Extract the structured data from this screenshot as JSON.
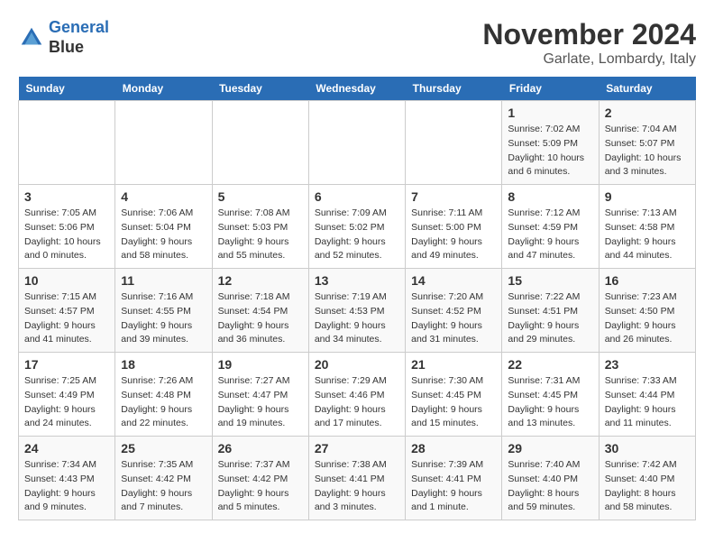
{
  "header": {
    "logo_line1": "General",
    "logo_line2": "Blue",
    "month_title": "November 2024",
    "location": "Garlate, Lombardy, Italy"
  },
  "weekdays": [
    "Sunday",
    "Monday",
    "Tuesday",
    "Wednesday",
    "Thursday",
    "Friday",
    "Saturday"
  ],
  "weeks": [
    [
      {
        "day": "",
        "info": ""
      },
      {
        "day": "",
        "info": ""
      },
      {
        "day": "",
        "info": ""
      },
      {
        "day": "",
        "info": ""
      },
      {
        "day": "",
        "info": ""
      },
      {
        "day": "1",
        "info": "Sunrise: 7:02 AM\nSunset: 5:09 PM\nDaylight: 10 hours\nand 6 minutes."
      },
      {
        "day": "2",
        "info": "Sunrise: 7:04 AM\nSunset: 5:07 PM\nDaylight: 10 hours\nand 3 minutes."
      }
    ],
    [
      {
        "day": "3",
        "info": "Sunrise: 7:05 AM\nSunset: 5:06 PM\nDaylight: 10 hours\nand 0 minutes."
      },
      {
        "day": "4",
        "info": "Sunrise: 7:06 AM\nSunset: 5:04 PM\nDaylight: 9 hours\nand 58 minutes."
      },
      {
        "day": "5",
        "info": "Sunrise: 7:08 AM\nSunset: 5:03 PM\nDaylight: 9 hours\nand 55 minutes."
      },
      {
        "day": "6",
        "info": "Sunrise: 7:09 AM\nSunset: 5:02 PM\nDaylight: 9 hours\nand 52 minutes."
      },
      {
        "day": "7",
        "info": "Sunrise: 7:11 AM\nSunset: 5:00 PM\nDaylight: 9 hours\nand 49 minutes."
      },
      {
        "day": "8",
        "info": "Sunrise: 7:12 AM\nSunset: 4:59 PM\nDaylight: 9 hours\nand 47 minutes."
      },
      {
        "day": "9",
        "info": "Sunrise: 7:13 AM\nSunset: 4:58 PM\nDaylight: 9 hours\nand 44 minutes."
      }
    ],
    [
      {
        "day": "10",
        "info": "Sunrise: 7:15 AM\nSunset: 4:57 PM\nDaylight: 9 hours\nand 41 minutes."
      },
      {
        "day": "11",
        "info": "Sunrise: 7:16 AM\nSunset: 4:55 PM\nDaylight: 9 hours\nand 39 minutes."
      },
      {
        "day": "12",
        "info": "Sunrise: 7:18 AM\nSunset: 4:54 PM\nDaylight: 9 hours\nand 36 minutes."
      },
      {
        "day": "13",
        "info": "Sunrise: 7:19 AM\nSunset: 4:53 PM\nDaylight: 9 hours\nand 34 minutes."
      },
      {
        "day": "14",
        "info": "Sunrise: 7:20 AM\nSunset: 4:52 PM\nDaylight: 9 hours\nand 31 minutes."
      },
      {
        "day": "15",
        "info": "Sunrise: 7:22 AM\nSunset: 4:51 PM\nDaylight: 9 hours\nand 29 minutes."
      },
      {
        "day": "16",
        "info": "Sunrise: 7:23 AM\nSunset: 4:50 PM\nDaylight: 9 hours\nand 26 minutes."
      }
    ],
    [
      {
        "day": "17",
        "info": "Sunrise: 7:25 AM\nSunset: 4:49 PM\nDaylight: 9 hours\nand 24 minutes."
      },
      {
        "day": "18",
        "info": "Sunrise: 7:26 AM\nSunset: 4:48 PM\nDaylight: 9 hours\nand 22 minutes."
      },
      {
        "day": "19",
        "info": "Sunrise: 7:27 AM\nSunset: 4:47 PM\nDaylight: 9 hours\nand 19 minutes."
      },
      {
        "day": "20",
        "info": "Sunrise: 7:29 AM\nSunset: 4:46 PM\nDaylight: 9 hours\nand 17 minutes."
      },
      {
        "day": "21",
        "info": "Sunrise: 7:30 AM\nSunset: 4:45 PM\nDaylight: 9 hours\nand 15 minutes."
      },
      {
        "day": "22",
        "info": "Sunrise: 7:31 AM\nSunset: 4:45 PM\nDaylight: 9 hours\nand 13 minutes."
      },
      {
        "day": "23",
        "info": "Sunrise: 7:33 AM\nSunset: 4:44 PM\nDaylight: 9 hours\nand 11 minutes."
      }
    ],
    [
      {
        "day": "24",
        "info": "Sunrise: 7:34 AM\nSunset: 4:43 PM\nDaylight: 9 hours\nand 9 minutes."
      },
      {
        "day": "25",
        "info": "Sunrise: 7:35 AM\nSunset: 4:42 PM\nDaylight: 9 hours\nand 7 minutes."
      },
      {
        "day": "26",
        "info": "Sunrise: 7:37 AM\nSunset: 4:42 PM\nDaylight: 9 hours\nand 5 minutes."
      },
      {
        "day": "27",
        "info": "Sunrise: 7:38 AM\nSunset: 4:41 PM\nDaylight: 9 hours\nand 3 minutes."
      },
      {
        "day": "28",
        "info": "Sunrise: 7:39 AM\nSunset: 4:41 PM\nDaylight: 9 hours\nand 1 minute."
      },
      {
        "day": "29",
        "info": "Sunrise: 7:40 AM\nSunset: 4:40 PM\nDaylight: 8 hours\nand 59 minutes."
      },
      {
        "day": "30",
        "info": "Sunrise: 7:42 AM\nSunset: 4:40 PM\nDaylight: 8 hours\nand 58 minutes."
      }
    ]
  ]
}
